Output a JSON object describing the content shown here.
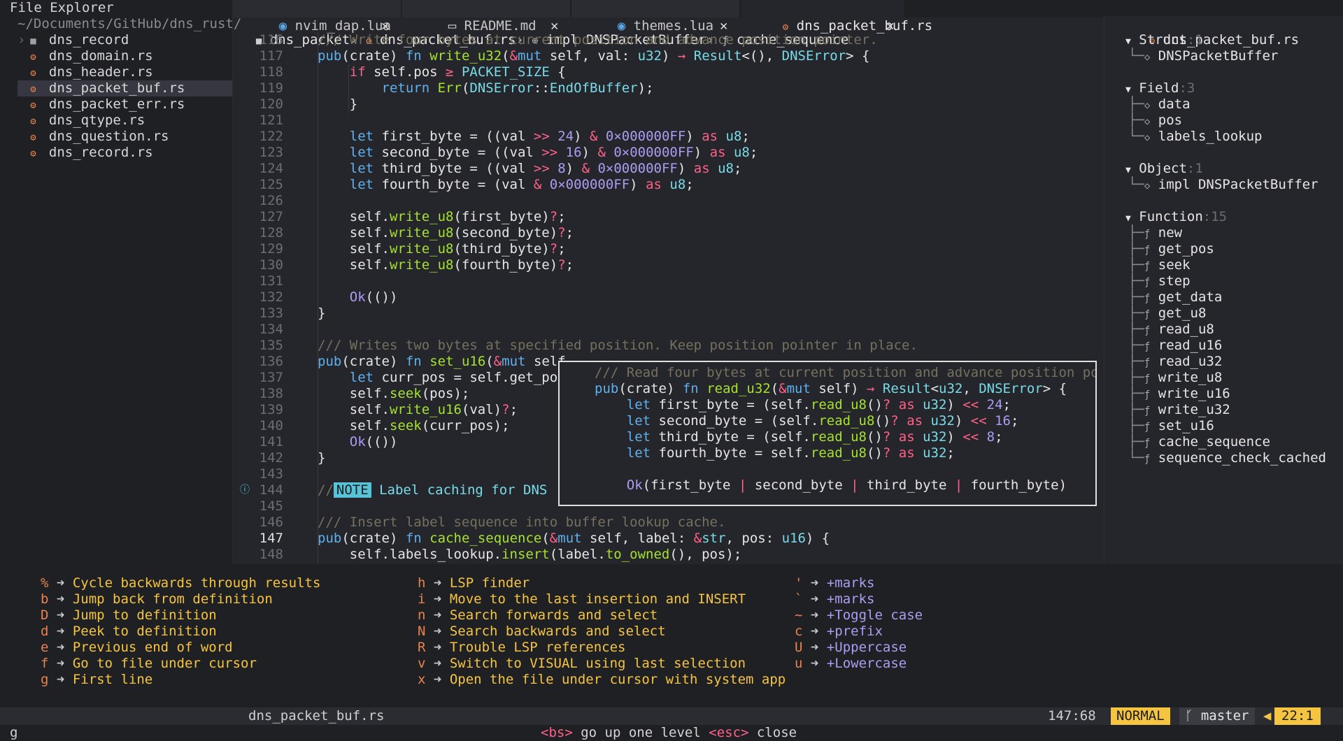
{
  "explorer": {
    "title": "File Explorer",
    "path": "~/Documents/GitHub/dns_rust/",
    "items": [
      {
        "label": "dns_record",
        "type": "folder"
      },
      {
        "label": "dns_domain.rs",
        "type": "file"
      },
      {
        "label": "dns_header.rs",
        "type": "file"
      },
      {
        "label": "dns_packet_buf.rs",
        "type": "file",
        "selected": true
      },
      {
        "label": "dns_packet_err.rs",
        "type": "file"
      },
      {
        "label": "dns_qtype.rs",
        "type": "file"
      },
      {
        "label": "dns_question.rs",
        "type": "file"
      },
      {
        "label": "dns_record.rs",
        "type": "file"
      }
    ]
  },
  "tabs": [
    {
      "label": "nvim_dap.lua",
      "icon": "lua-icon"
    },
    {
      "label": "README.md",
      "icon": "markdown-icon"
    },
    {
      "label": "themes.lua",
      "icon": "lua-icon"
    },
    {
      "label": "dns_packet_buf.rs",
      "icon": "rust-icon",
      "active": true
    }
  ],
  "breadcrumb": [
    "dns_packet",
    "dns_packet_buf.rs",
    "impl DNSPacketBuffer",
    "cache_sequence"
  ],
  "editor": {
    "current_line": "147",
    "lines": [
      {
        "n": "116",
        "t": "/// Write four bytes at current position and advance position pointer."
      },
      {
        "n": "117",
        "t": "pub(crate) fn write_u32(&mut self, val: u32) → Result<(), DNSError> {"
      },
      {
        "n": "118",
        "t": "    if self.pos ≥ PACKET_SIZE {"
      },
      {
        "n": "119",
        "t": "        return Err(DNSError::EndOfBuffer);"
      },
      {
        "n": "120",
        "t": "    }"
      },
      {
        "n": "121",
        "t": ""
      },
      {
        "n": "122",
        "t": "    let first_byte = ((val >> 24) & 0×000000FF) as u8;"
      },
      {
        "n": "123",
        "t": "    let second_byte = ((val >> 16) & 0×000000FF) as u8;"
      },
      {
        "n": "124",
        "t": "    let third_byte = ((val >> 8) & 0×000000FF) as u8;"
      },
      {
        "n": "125",
        "t": "    let fourth_byte = (val & 0×000000FF) as u8;"
      },
      {
        "n": "126",
        "t": ""
      },
      {
        "n": "127",
        "t": "    self.write_u8(first_byte)?;"
      },
      {
        "n": "128",
        "t": "    self.write_u8(second_byte)?;"
      },
      {
        "n": "129",
        "t": "    self.write_u8(third_byte)?;"
      },
      {
        "n": "130",
        "t": "    self.write_u8(fourth_byte)?;"
      },
      {
        "n": "131",
        "t": ""
      },
      {
        "n": "132",
        "t": "    Ok(())"
      },
      {
        "n": "133",
        "t": "}"
      },
      {
        "n": "134",
        "t": ""
      },
      {
        "n": "135",
        "t": "/// Writes two bytes at specified position. Keep position pointer in place."
      },
      {
        "n": "136",
        "t": "pub(crate) fn set_u16(&mut self"
      },
      {
        "n": "137",
        "t": "    let curr_pos = self.get_pos"
      },
      {
        "n": "138",
        "t": "    self.seek(pos);"
      },
      {
        "n": "139",
        "t": "    self.write_u16(val)?;"
      },
      {
        "n": "140",
        "t": "    self.seek(curr_pos);"
      },
      {
        "n": "141",
        "t": "    Ok(())"
      },
      {
        "n": "142",
        "t": "}"
      },
      {
        "n": "143",
        "t": ""
      },
      {
        "n": "144",
        "t": "// NOTE Label caching for DNS"
      },
      {
        "n": "145",
        "t": ""
      },
      {
        "n": "146",
        "t": "/// Insert label sequence into buffer lookup cache."
      },
      {
        "n": "147",
        "t": "pub(crate) fn cache_sequence(&mut self, label: &str, pos: u16) {"
      },
      {
        "n": "148",
        "t": "    self.labels_lookup.insert(label.to_owned(), pos);"
      }
    ],
    "note_tag": "NOTE",
    "note_text": "Label caching for DNS"
  },
  "hover": {
    "lines": [
      "/// Read four bytes at current position and advance position poin",
      "pub(crate) fn read_u32(&mut self) → Result<u32, DNSError> {",
      "    let first_byte = (self.read_u8()? as u32) << 24;",
      "    let second_byte = (self.read_u8()? as u32) << 16;",
      "    let third_byte = (self.read_u8()? as u32) << 8;",
      "    let fourth_byte = self.read_u8()? as u32;",
      "",
      "    Ok(first_byte | second_byte | third_byte | fourth_byte)"
    ]
  },
  "outline": {
    "file": "dns_packet_buf.rs",
    "groups": [
      {
        "label": "Struct",
        "count": "1",
        "items": [
          "DNSPacketBuffer"
        ]
      },
      {
        "label": "Field",
        "count": "3",
        "items": [
          "data",
          "pos",
          "labels_lookup"
        ]
      },
      {
        "label": "Object",
        "count": "1",
        "items": [
          "impl DNSPacketBuffer"
        ]
      },
      {
        "label": "Function",
        "count": "15",
        "items": [
          "new",
          "get_pos",
          "seek",
          "step",
          "get_data",
          "get_u8",
          "read_u8",
          "read_u16",
          "read_u32",
          "write_u8",
          "write_u16",
          "write_u32",
          "set_u16",
          "cache_sequence",
          "sequence_check_cached"
        ]
      }
    ]
  },
  "whichkey": {
    "columns": [
      [
        {
          "k": "%",
          "d": "Cycle backwards through results"
        },
        {
          "k": "b",
          "d": "Jump back from definition"
        },
        {
          "k": "D",
          "d": "Jump to definition"
        },
        {
          "k": "d",
          "d": "Peek to definition"
        },
        {
          "k": "e",
          "d": "Previous end of word"
        },
        {
          "k": "f",
          "d": "Go to file under cursor"
        },
        {
          "k": "g",
          "d": "First line"
        }
      ],
      [
        {
          "k": "h",
          "d": "LSP finder"
        },
        {
          "k": "i",
          "d": "Move to the last insertion and INSERT"
        },
        {
          "k": "n",
          "d": "Search forwards and select"
        },
        {
          "k": "N",
          "d": "Search backwards and select"
        },
        {
          "k": "R",
          "d": "Trouble LSP references"
        },
        {
          "k": "v",
          "d": "Switch to VISUAL using last selection"
        },
        {
          "k": "x",
          "d": "Open the file under cursor with system app"
        }
      ],
      [
        {
          "k": "'",
          "d": "+marks",
          "group": true
        },
        {
          "k": "`",
          "d": "+marks",
          "group": true
        },
        {
          "k": "~",
          "d": "+Toggle case",
          "group": true
        },
        {
          "k": "c",
          "d": "+prefix",
          "group": true
        },
        {
          "k": "U",
          "d": "+Uppercase",
          "group": true
        },
        {
          "k": "u",
          "d": "+Lowercase",
          "group": true
        }
      ]
    ],
    "arrow": "➜"
  },
  "statusline": {
    "filename": "dns_packet_buf.rs",
    "cursor": "147:68",
    "mode": "NORMAL",
    "branch": "master",
    "position": "22:1"
  },
  "cmdline": {
    "pending": "g",
    "hint_bs_key": "<bs>",
    "hint_bs": "go up one level",
    "hint_esc_key": "<esc>",
    "hint_esc": "close"
  }
}
